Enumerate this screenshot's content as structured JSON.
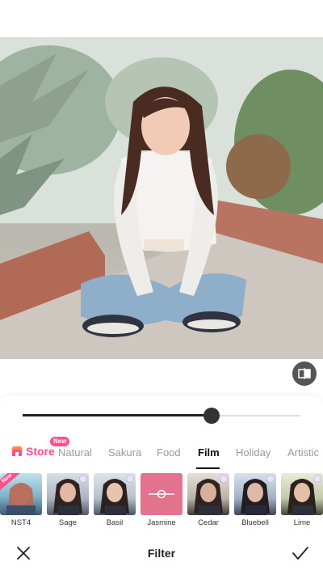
{
  "photo": {
    "alt_subject": "girl-sitting-cross-legged-in-garden"
  },
  "editor": {
    "intensity_value": 0.68,
    "compare_icon": "compare-icon"
  },
  "tabs": {
    "store_label": "Store",
    "store_badge": "New",
    "items": [
      "Natural",
      "Sakura",
      "Food",
      "Film",
      "Holiday",
      "Artistic"
    ],
    "active": "Film"
  },
  "filters": [
    {
      "label": "NST4",
      "badge": "New",
      "premium": false
    },
    {
      "label": "Sage",
      "premium": true
    },
    {
      "label": "Basil",
      "premium": true
    },
    {
      "label": "Jasmine",
      "premium": false,
      "selected": true
    },
    {
      "label": "Cedar",
      "premium": true
    },
    {
      "label": "Bluebell",
      "premium": true
    },
    {
      "label": "Lime",
      "premium": true
    }
  ],
  "bottom_bar": {
    "title": "Filter",
    "close_icon": "close-icon",
    "confirm_icon": "check-icon"
  },
  "colors": {
    "accent": "#ff4f8b",
    "active_text": "#111111",
    "inactive_text": "#9a9a9a",
    "selected_thumb": "#e3728f"
  }
}
